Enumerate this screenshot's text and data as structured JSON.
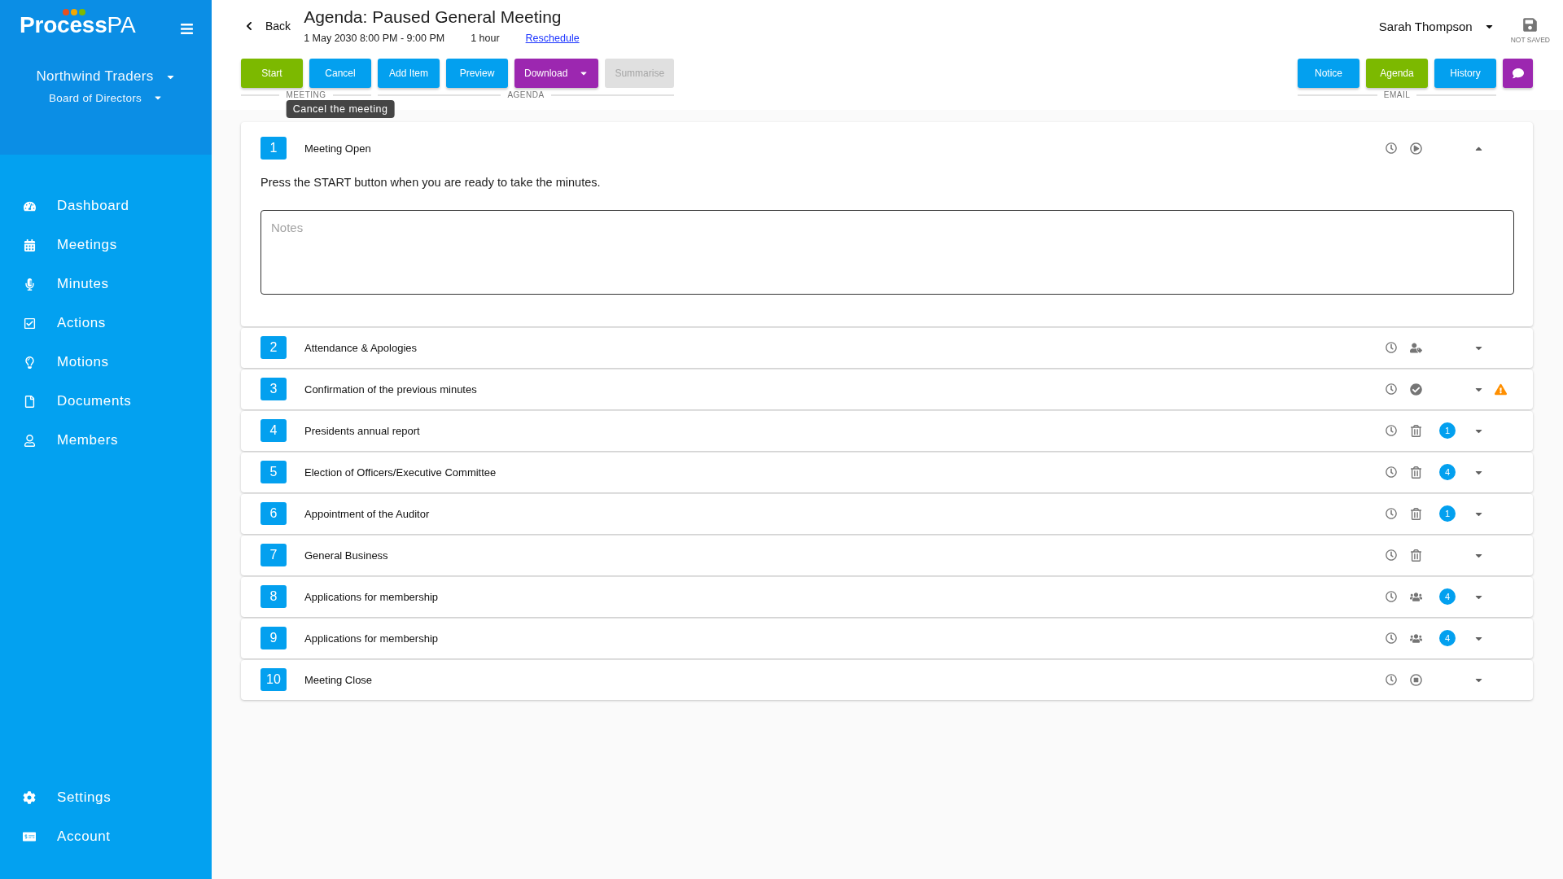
{
  "sidebar": {
    "brand": "**Process**PA",
    "organisation": "Northwind Traders",
    "committee": "Board of Directors",
    "nav": [
      "Dashboard",
      "Meetings",
      "Minutes",
      "Actions",
      "Motions",
      "Documents",
      "Members"
    ],
    "footer_nav": [
      "Settings",
      "Account"
    ]
  },
  "header": {
    "back": "Back",
    "title": "Agenda: Paused General Meeting",
    "datetime": "1 May 2030 8:00 PM - 9:00 PM",
    "duration": "1 hour",
    "reschedule": "Reschedule",
    "user": "Sarah Thompson",
    "save_status": "NOT SAVED"
  },
  "toolbar": {
    "groups": [
      {
        "label": "MEETING",
        "buttons": [
          {
            "label": "Start",
            "kind": "plain",
            "color": "#7cb900",
            "disabled": false
          },
          {
            "label": "Cancel",
            "kind": "plain",
            "color": "#03a0ef",
            "disabled": false,
            "tooltip": "Cancel the meeting"
          }
        ]
      },
      {
        "label": "AGENDA",
        "buttons": [
          {
            "label": "Add Item",
            "kind": "plain",
            "color": "#03a0ef",
            "disabled": false
          },
          {
            "label": "Preview",
            "kind": "plain",
            "color": "#03a0ef",
            "disabled": false
          },
          {
            "label": "Download",
            "kind": "dropdown",
            "color": "#9c27b0",
            "disabled": false
          },
          {
            "label": "Summarise",
            "kind": "plain",
            "disabled": true
          }
        ]
      }
    ],
    "email_group": {
      "label": "EMAIL",
      "buttons": [
        {
          "label": "Notice",
          "kind": "plain",
          "color": "#03a0ef",
          "disabled": false
        },
        {
          "label": "Agenda",
          "kind": "plain",
          "color": "#7cb900",
          "disabled": false
        },
        {
          "label": "History",
          "kind": "plain",
          "color": "#03a0ef",
          "disabled": false
        }
      ]
    },
    "chat_button": {
      "color": "#9c27b0"
    }
  },
  "agenda_items": [
    {
      "number": "1",
      "title": "Meeting Open",
      "kind": "play",
      "expanded": true,
      "warning": false,
      "description": "Press the START button when you are ready to take the minutes.",
      "notes_placeholder": "Notes"
    },
    {
      "number": "2",
      "title": "Attendance & Apologies",
      "kind": "person",
      "expanded": false,
      "warning": false
    },
    {
      "number": "3",
      "title": "Confirmation of the previous minutes",
      "kind": "check",
      "expanded": false,
      "warning": true
    },
    {
      "number": "4",
      "title": "Presidents annual report",
      "kind": "trash",
      "expanded": false,
      "warning": false,
      "count": "1"
    },
    {
      "number": "5",
      "title": "Election of Officers/Executive Committee",
      "kind": "trash",
      "expanded": false,
      "warning": false,
      "count": "4"
    },
    {
      "number": "6",
      "title": "Appointment of the Auditor",
      "kind": "trash",
      "expanded": false,
      "warning": false,
      "count": "1"
    },
    {
      "number": "7",
      "title": "General Business",
      "kind": "trash",
      "expanded": false,
      "warning": false
    },
    {
      "number": "8",
      "title": "Applications for membership",
      "kind": "group",
      "expanded": false,
      "warning": false,
      "count": "4"
    },
    {
      "number": "9",
      "title": "Applications for membership",
      "kind": "group",
      "expanded": false,
      "warning": false,
      "count": "4"
    },
    {
      "number": "10",
      "title": "Meeting Close",
      "kind": "stop",
      "expanded": false,
      "warning": false
    }
  ]
}
